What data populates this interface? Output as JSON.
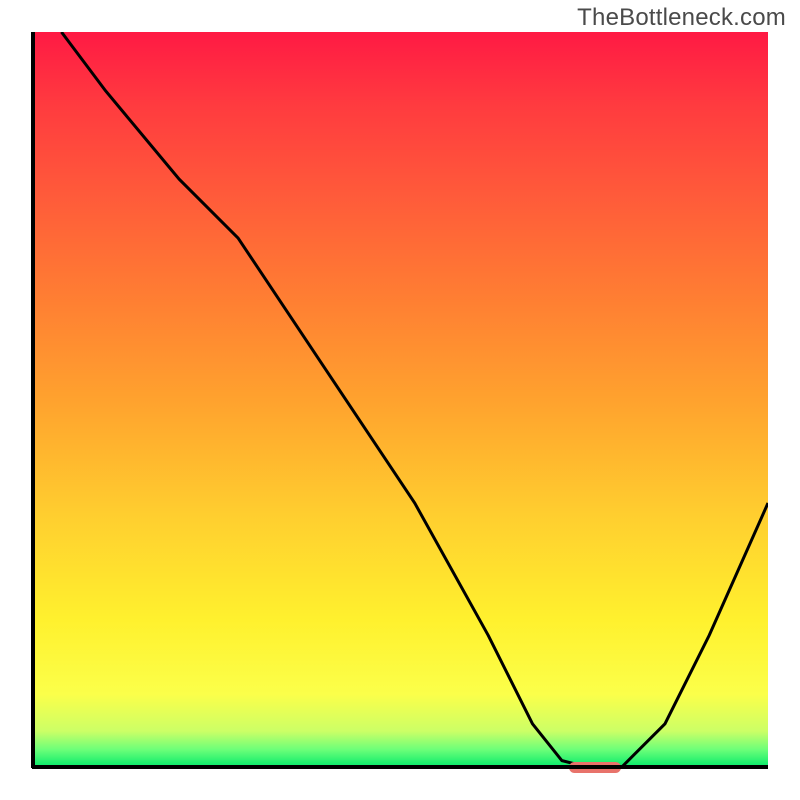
{
  "watermark": "TheBottleneck.com",
  "chart_data": {
    "type": "line",
    "title": "",
    "xlabel": "",
    "ylabel": "",
    "xlim": [
      0,
      100
    ],
    "ylim": [
      0,
      100
    ],
    "grid": false,
    "legend": false,
    "series": [
      {
        "name": "curve",
        "color": "#000000",
        "x": [
          4,
          10,
          20,
          28,
          40,
          52,
          62,
          68,
          72,
          76,
          80,
          86,
          92,
          100
        ],
        "y": [
          100,
          92,
          80,
          72,
          54,
          36,
          18,
          6,
          1,
          0,
          0,
          6,
          18,
          36
        ]
      }
    ],
    "marker": {
      "description": "optimal region",
      "color": "#e8736b",
      "x_start": 73,
      "x_end": 80,
      "y": 0
    },
    "background": {
      "description": "vertical gradient backdrop indicating bottleneck severity (red=high, green=low)",
      "stops": [
        {
          "pct": 0,
          "color": "#ff1a44"
        },
        {
          "pct": 50,
          "color": "#ffa22e"
        },
        {
          "pct": 80,
          "color": "#fff12e"
        },
        {
          "pct": 97.5,
          "color": "#6cff79"
        },
        {
          "pct": 100,
          "color": "#00e96a"
        }
      ]
    }
  }
}
